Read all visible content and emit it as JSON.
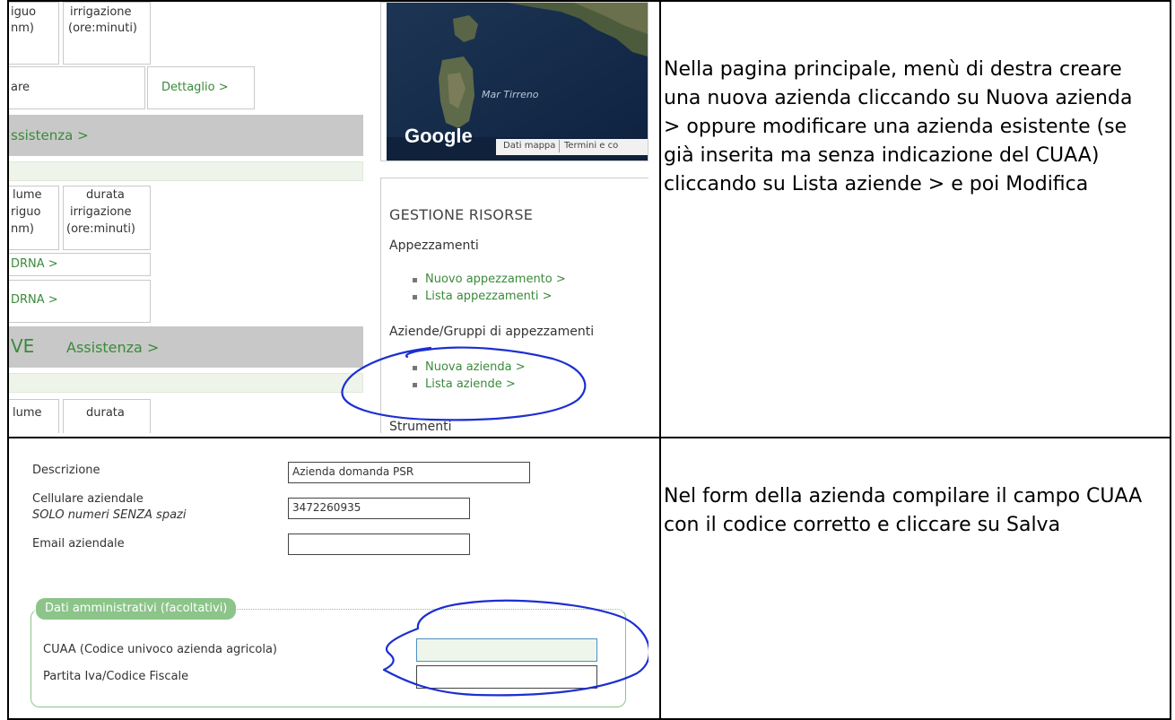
{
  "row1": {
    "instruction": "Nella pagina principale, menù di destra creare una nuova azienda cliccando su Nuova azienda > oppure modificare una azienda esistente (se già inserita ma senza indicazione del CUAA) cliccando su Lista aziende > e poi Modifica",
    "left_table": {
      "h1a": "iguo",
      "h1b": "nm)",
      "h2a": "irrigazione",
      "h2b": "(ore:minuti)",
      "are": "are",
      "dettaglio": "Dettaglio >",
      "assistenza1": "ssistenza >",
      "c1a": "lume",
      "c1b": "riguo",
      "c1c": "nm)",
      "c2a": "durata",
      "c2b": "irrigazione",
      "c2c": "(ore:minuti)",
      "orna1": "DRNA >",
      "orna2": "DRNA >",
      "ve": "VE",
      "assistenza2": "Assistenza >",
      "lume2": "lume",
      "durata2": "durata"
    },
    "map": {
      "sea_label": "Mar Tirreno",
      "logo": "Google",
      "footer_data": "Dati mappa",
      "footer_terms": "Termini e co"
    },
    "risorse": {
      "title": "GESTIONE RISORSE",
      "section1": "Appezzamenti",
      "item1": "Nuovo appezzamento >",
      "item2": "Lista appezzamenti >",
      "section2": "Aziende/Gruppi di appezzamenti",
      "item3": "Nuova azienda >",
      "item4": "Lista aziende >",
      "section3": "Strumenti"
    }
  },
  "row2": {
    "instruction": "Nel form della azienda compilare il campo CUAA con il codice corretto e cliccare su Salva",
    "form": {
      "descrizione_label": "Descrizione",
      "descrizione_value": "Azienda domanda PSR",
      "cellulare_label": "Cellulare aziendale",
      "cellulare_hint": "SOLO numeri SENZA spazi",
      "cellulare_value": "3472260935",
      "email_label": "Email aziendale",
      "email_value": "",
      "legend": "Dati amministrativi (facoltativi)",
      "cuaa_label": "CUAA (Codice univoco azienda agricola)",
      "cuaa_value": "",
      "piva_label": "Partita Iva/Codice Fiscale",
      "piva_value": ""
    }
  },
  "colors": {
    "green_link": "#3a8a3a",
    "legend_bg": "#8cc48a",
    "annotation_blue": "#1c2fd1",
    "cuaa_bg": "#eef6ec"
  }
}
